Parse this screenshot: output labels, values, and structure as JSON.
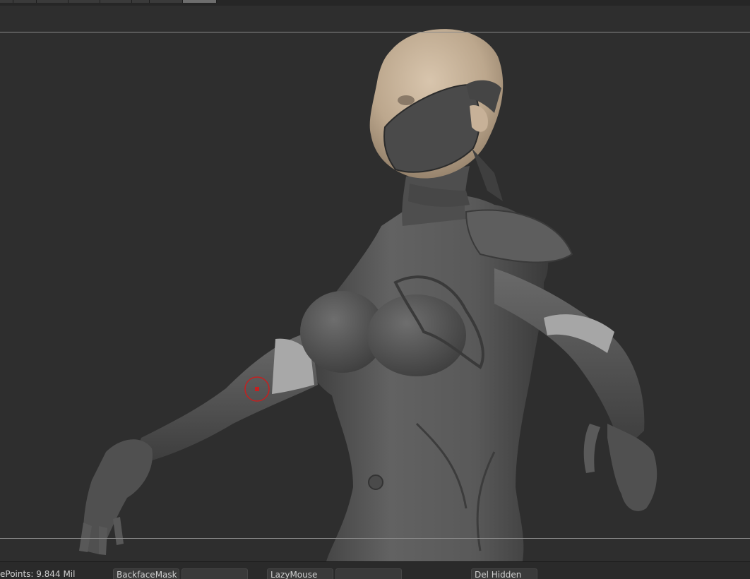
{
  "status_bar": {
    "active_points": "ePoints: 9.844 Mil",
    "backface_mask": "BackfaceMask",
    "lazy_mouse": "LazyMouse",
    "del_hidden": "Del Hidden"
  },
  "colors": {
    "viewport_bg": "#2e2e2e",
    "model_gray": "#5a5a5a",
    "skin": "#c9b49a",
    "brush_cursor": "#c42020"
  }
}
